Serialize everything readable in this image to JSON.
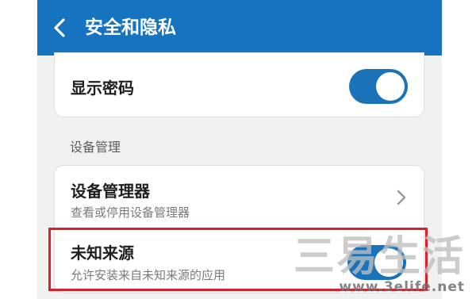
{
  "header": {
    "title": "安全和隐私"
  },
  "show_password": {
    "label": "显示密码",
    "enabled": true
  },
  "section": {
    "label": "设备管理"
  },
  "device_admin": {
    "title": "设备管理器",
    "subtitle": "查看或停用设备管理器"
  },
  "unknown_sources": {
    "title": "未知来源",
    "subtitle": "允许安装来自未知来源的应用",
    "enabled": true
  },
  "watermark": {
    "text": "三易生活",
    "url": "www.3elife.net"
  },
  "colors": {
    "header": "#1573c0",
    "toggle_on": "#1a73b8",
    "highlight": "#d9212a"
  }
}
